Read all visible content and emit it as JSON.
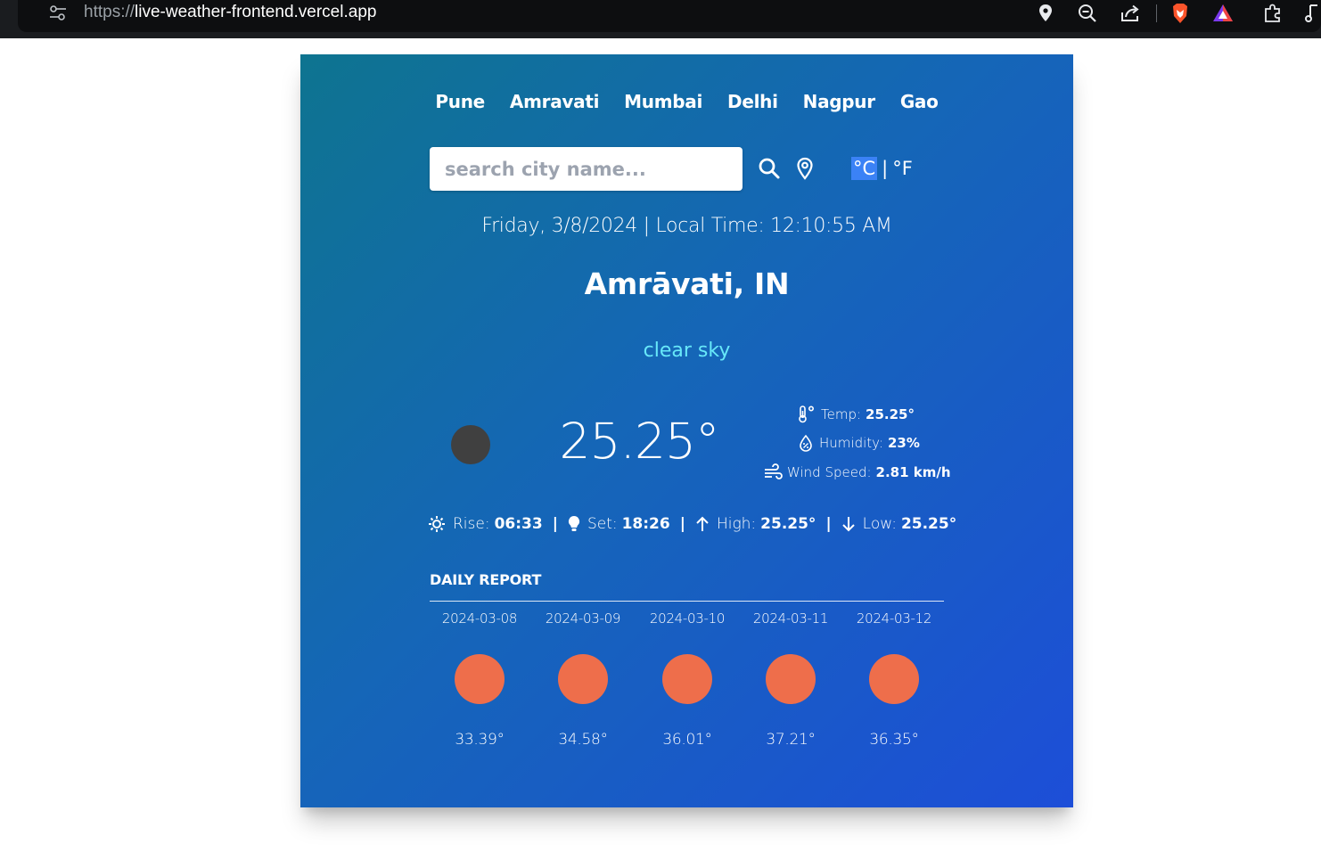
{
  "browser": {
    "url_scheme": "https://",
    "url_host": "live-weather-frontend.vercel.app"
  },
  "nav": {
    "cities": [
      {
        "label": "Pune"
      },
      {
        "label": "Amravati"
      },
      {
        "label": "Mumbai"
      },
      {
        "label": "Delhi"
      },
      {
        "label": "Nagpur"
      },
      {
        "label": "Gao"
      }
    ]
  },
  "search": {
    "placeholder": "search city name...",
    "value": ""
  },
  "units": {
    "celsius": "°C",
    "separator": "|",
    "fahrenheit": "°F",
    "selected": "celsius"
  },
  "datetime": "Friday, 3/8/2024 | Local Time: 12:10:55 AM",
  "location": "Amrāvati, IN",
  "condition": "clear sky",
  "current": {
    "temp_big": "25.25°",
    "icon_color": "#404040",
    "temp_label": "Temp:",
    "temp_value": "25.25°",
    "humidity_label": "Humidity:",
    "humidity_value": "23%",
    "wind_label": "Wind Speed:",
    "wind_value": "2.81 km/h"
  },
  "sun": {
    "rise_label": "Rise:",
    "rise_value": "06:33",
    "set_label": "Set:",
    "set_value": "18:26",
    "high_label": "High:",
    "high_value": "25.25°",
    "low_label": "Low:",
    "low_value": "25.25°",
    "pipe": "|"
  },
  "daily": {
    "title": "DAILY REPORT",
    "icon_color": "#ee6e4b",
    "days": [
      {
        "date": "2024-03-08",
        "temp": "33.39°"
      },
      {
        "date": "2024-03-09",
        "temp": "34.58°"
      },
      {
        "date": "2024-03-10",
        "temp": "36.01°"
      },
      {
        "date": "2024-03-11",
        "temp": "37.21°"
      },
      {
        "date": "2024-03-12",
        "temp": "36.35°"
      }
    ]
  },
  "colors": {
    "gradient_start": "#0e7490",
    "gradient_end": "#1d4ed8",
    "condition_text": "#67e8f9",
    "unit_highlight": "#3b82f6"
  }
}
